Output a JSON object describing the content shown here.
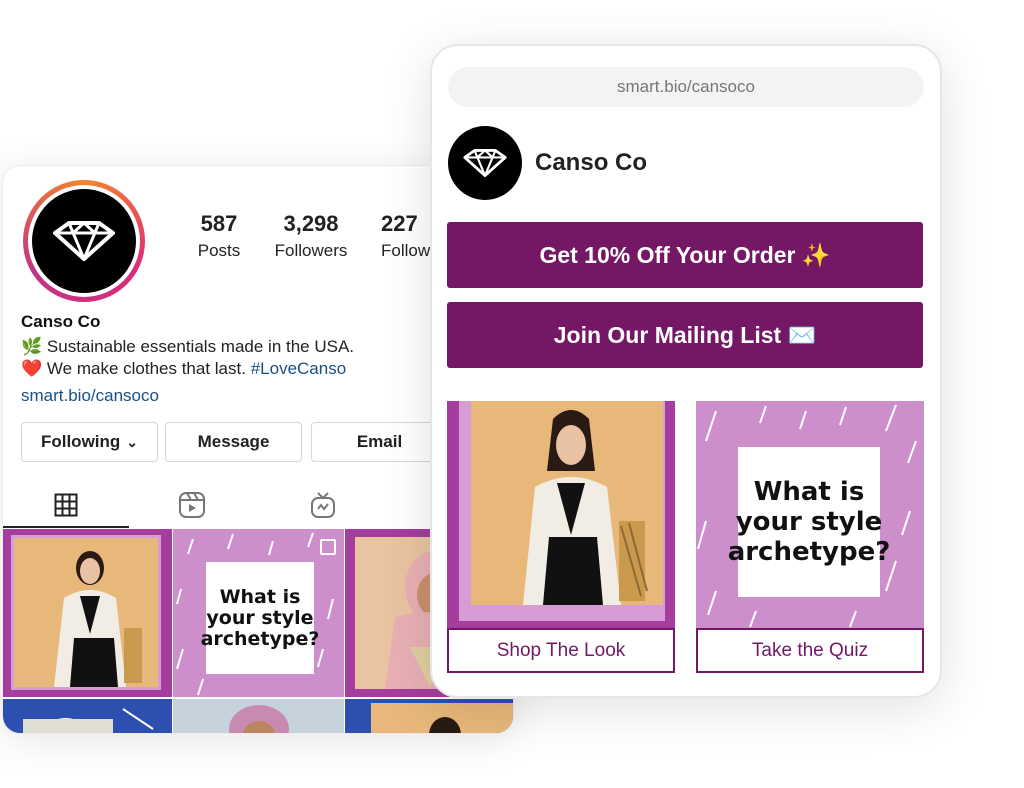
{
  "instagram": {
    "stats": [
      {
        "value": "587",
        "label": "Posts"
      },
      {
        "value": "3,298",
        "label": "Followers"
      },
      {
        "value": "227",
        "label": "Following"
      }
    ],
    "profile_name": "Canso Co",
    "bio_line1": "Sustainable essentials made in the USA.",
    "bio_line1_emoji": "🌿",
    "bio_line2": "We make clothes that last.",
    "bio_line2_emoji": "❤️",
    "bio_hashtag": "#LoveCanso",
    "bio_link": "smart.bio/cansoco",
    "buttons": {
      "following": "Following",
      "following_caret": "⌄",
      "message": "Message",
      "email": "Email"
    },
    "tabs": [
      "grid-icon",
      "reels-icon",
      "igtv-icon"
    ],
    "quiz_text_line1": "What is",
    "quiz_text_line2": "your style",
    "quiz_text_line3": "archetype?"
  },
  "smartbio": {
    "url": "smart.bio/cansoco",
    "brand_name": "Canso Co",
    "cta1": "Get 10% Off Your Order ✨",
    "cta2": "Join Our Mailing List ✉️",
    "tile1_caption": "Shop The Look",
    "tile2_caption": "Take the Quiz",
    "quiz_line1": "What is",
    "quiz_line2": "your style",
    "quiz_line3": "archetype?"
  },
  "colors": {
    "accent_purple": "#741865",
    "lilac": "#cc8fcc",
    "link_blue": "#1a4f8a",
    "tile_bg": "#e8b87a"
  }
}
